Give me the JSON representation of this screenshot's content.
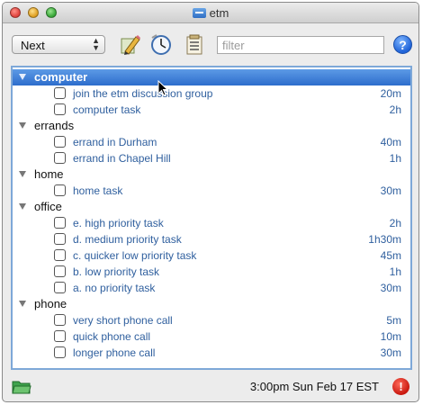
{
  "window": {
    "title": "etm"
  },
  "toolbar": {
    "view_select": "Next",
    "filter_placeholder": "filter"
  },
  "list": [
    {
      "group": "computer",
      "selected": true,
      "tasks": [
        {
          "name": "join the etm discussion group",
          "duration": "20m"
        },
        {
          "name": "computer task",
          "duration": "2h"
        }
      ]
    },
    {
      "group": "errands",
      "selected": false,
      "tasks": [
        {
          "name": "errand in Durham",
          "duration": "40m"
        },
        {
          "name": "errand in Chapel Hill",
          "duration": "1h"
        }
      ]
    },
    {
      "group": "home",
      "selected": false,
      "tasks": [
        {
          "name": "home task",
          "duration": "30m"
        }
      ]
    },
    {
      "group": "office",
      "selected": false,
      "tasks": [
        {
          "name": "e. high priority task",
          "duration": "2h"
        },
        {
          "name": "d. medium priority task",
          "duration": "1h30m"
        },
        {
          "name": "c. quicker low priority task",
          "duration": "45m"
        },
        {
          "name": "b. low priority task",
          "duration": "1h"
        },
        {
          "name": "a. no priority task",
          "duration": "30m"
        }
      ]
    },
    {
      "group": "phone",
      "selected": false,
      "tasks": [
        {
          "name": "very short phone call",
          "duration": "5m"
        },
        {
          "name": "quick phone call",
          "duration": "10m"
        },
        {
          "name": "longer phone call",
          "duration": "30m"
        }
      ]
    }
  ],
  "statusbar": {
    "datetime": "3:00pm Sun Feb 17 EST"
  },
  "colors": {
    "selection": "#3a7bd5",
    "task_text": "#2f5f9e",
    "alert": "#d0231a",
    "help": "#2a6fdb"
  },
  "icons": {
    "toolbar": [
      "pencil-icon",
      "clock-icon",
      "list-icon"
    ],
    "help": "help-icon",
    "status_left": "folder-icon",
    "status_right": "alert-icon"
  }
}
